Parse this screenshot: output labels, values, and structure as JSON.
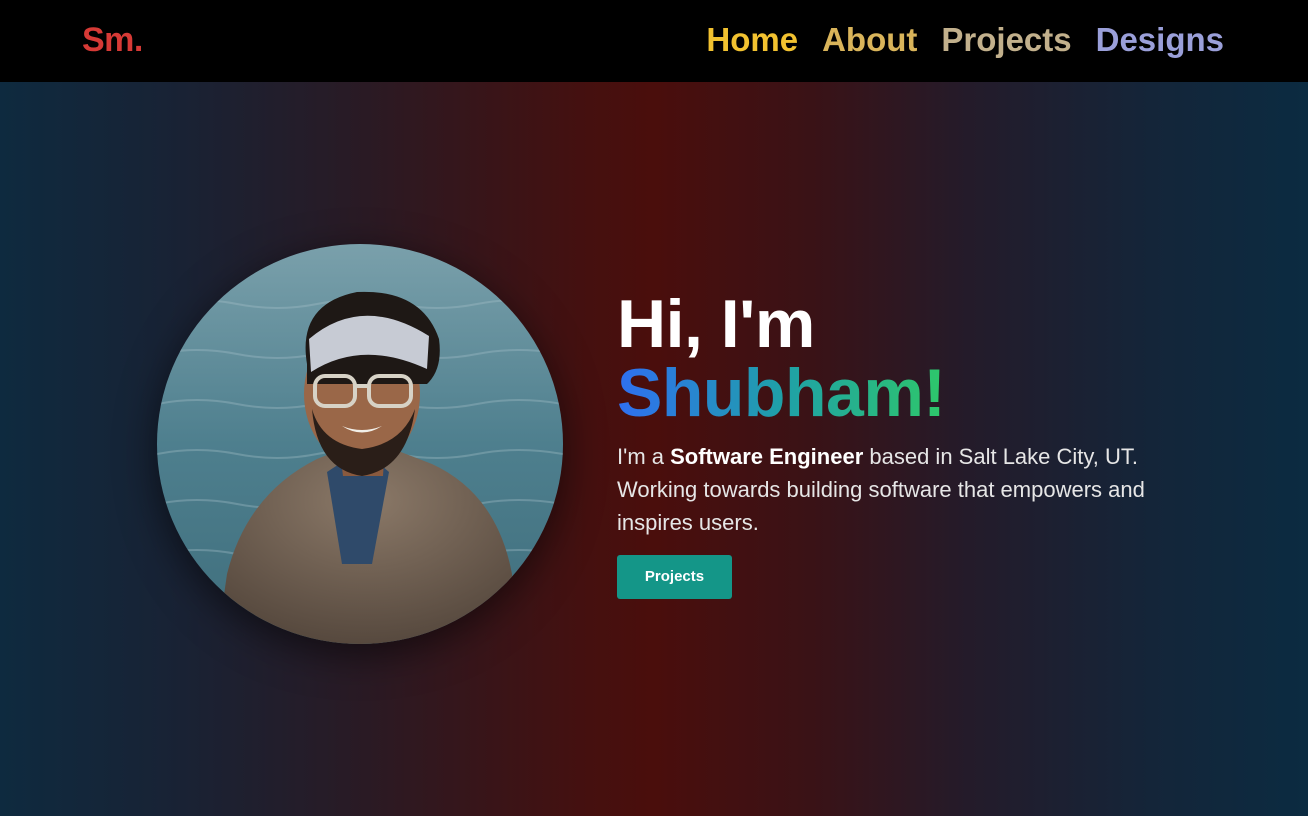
{
  "nav": {
    "logo": "Sm.",
    "logo_color": "#d63a36",
    "links": [
      {
        "label": "Home",
        "color": "#f2c230"
      },
      {
        "label": "About",
        "color": "#d9b45a"
      },
      {
        "label": "Projects",
        "color": "#c2b08c"
      },
      {
        "label": "Designs",
        "color": "#9a9fd9"
      }
    ]
  },
  "hero": {
    "greeting": "Hi, I'm",
    "name": "Shubham!",
    "bio_prefix": "I'm a ",
    "bio_role": "Software Engineer",
    "bio_suffix": " based in Salt Lake City, UT. Working towards building software that empowers and inspires users.",
    "cta_label": "Projects",
    "cta_color": "#149688",
    "name_gradient": [
      "#2f6ff1",
      "#1fa0a8",
      "#2ec76a"
    ]
  }
}
